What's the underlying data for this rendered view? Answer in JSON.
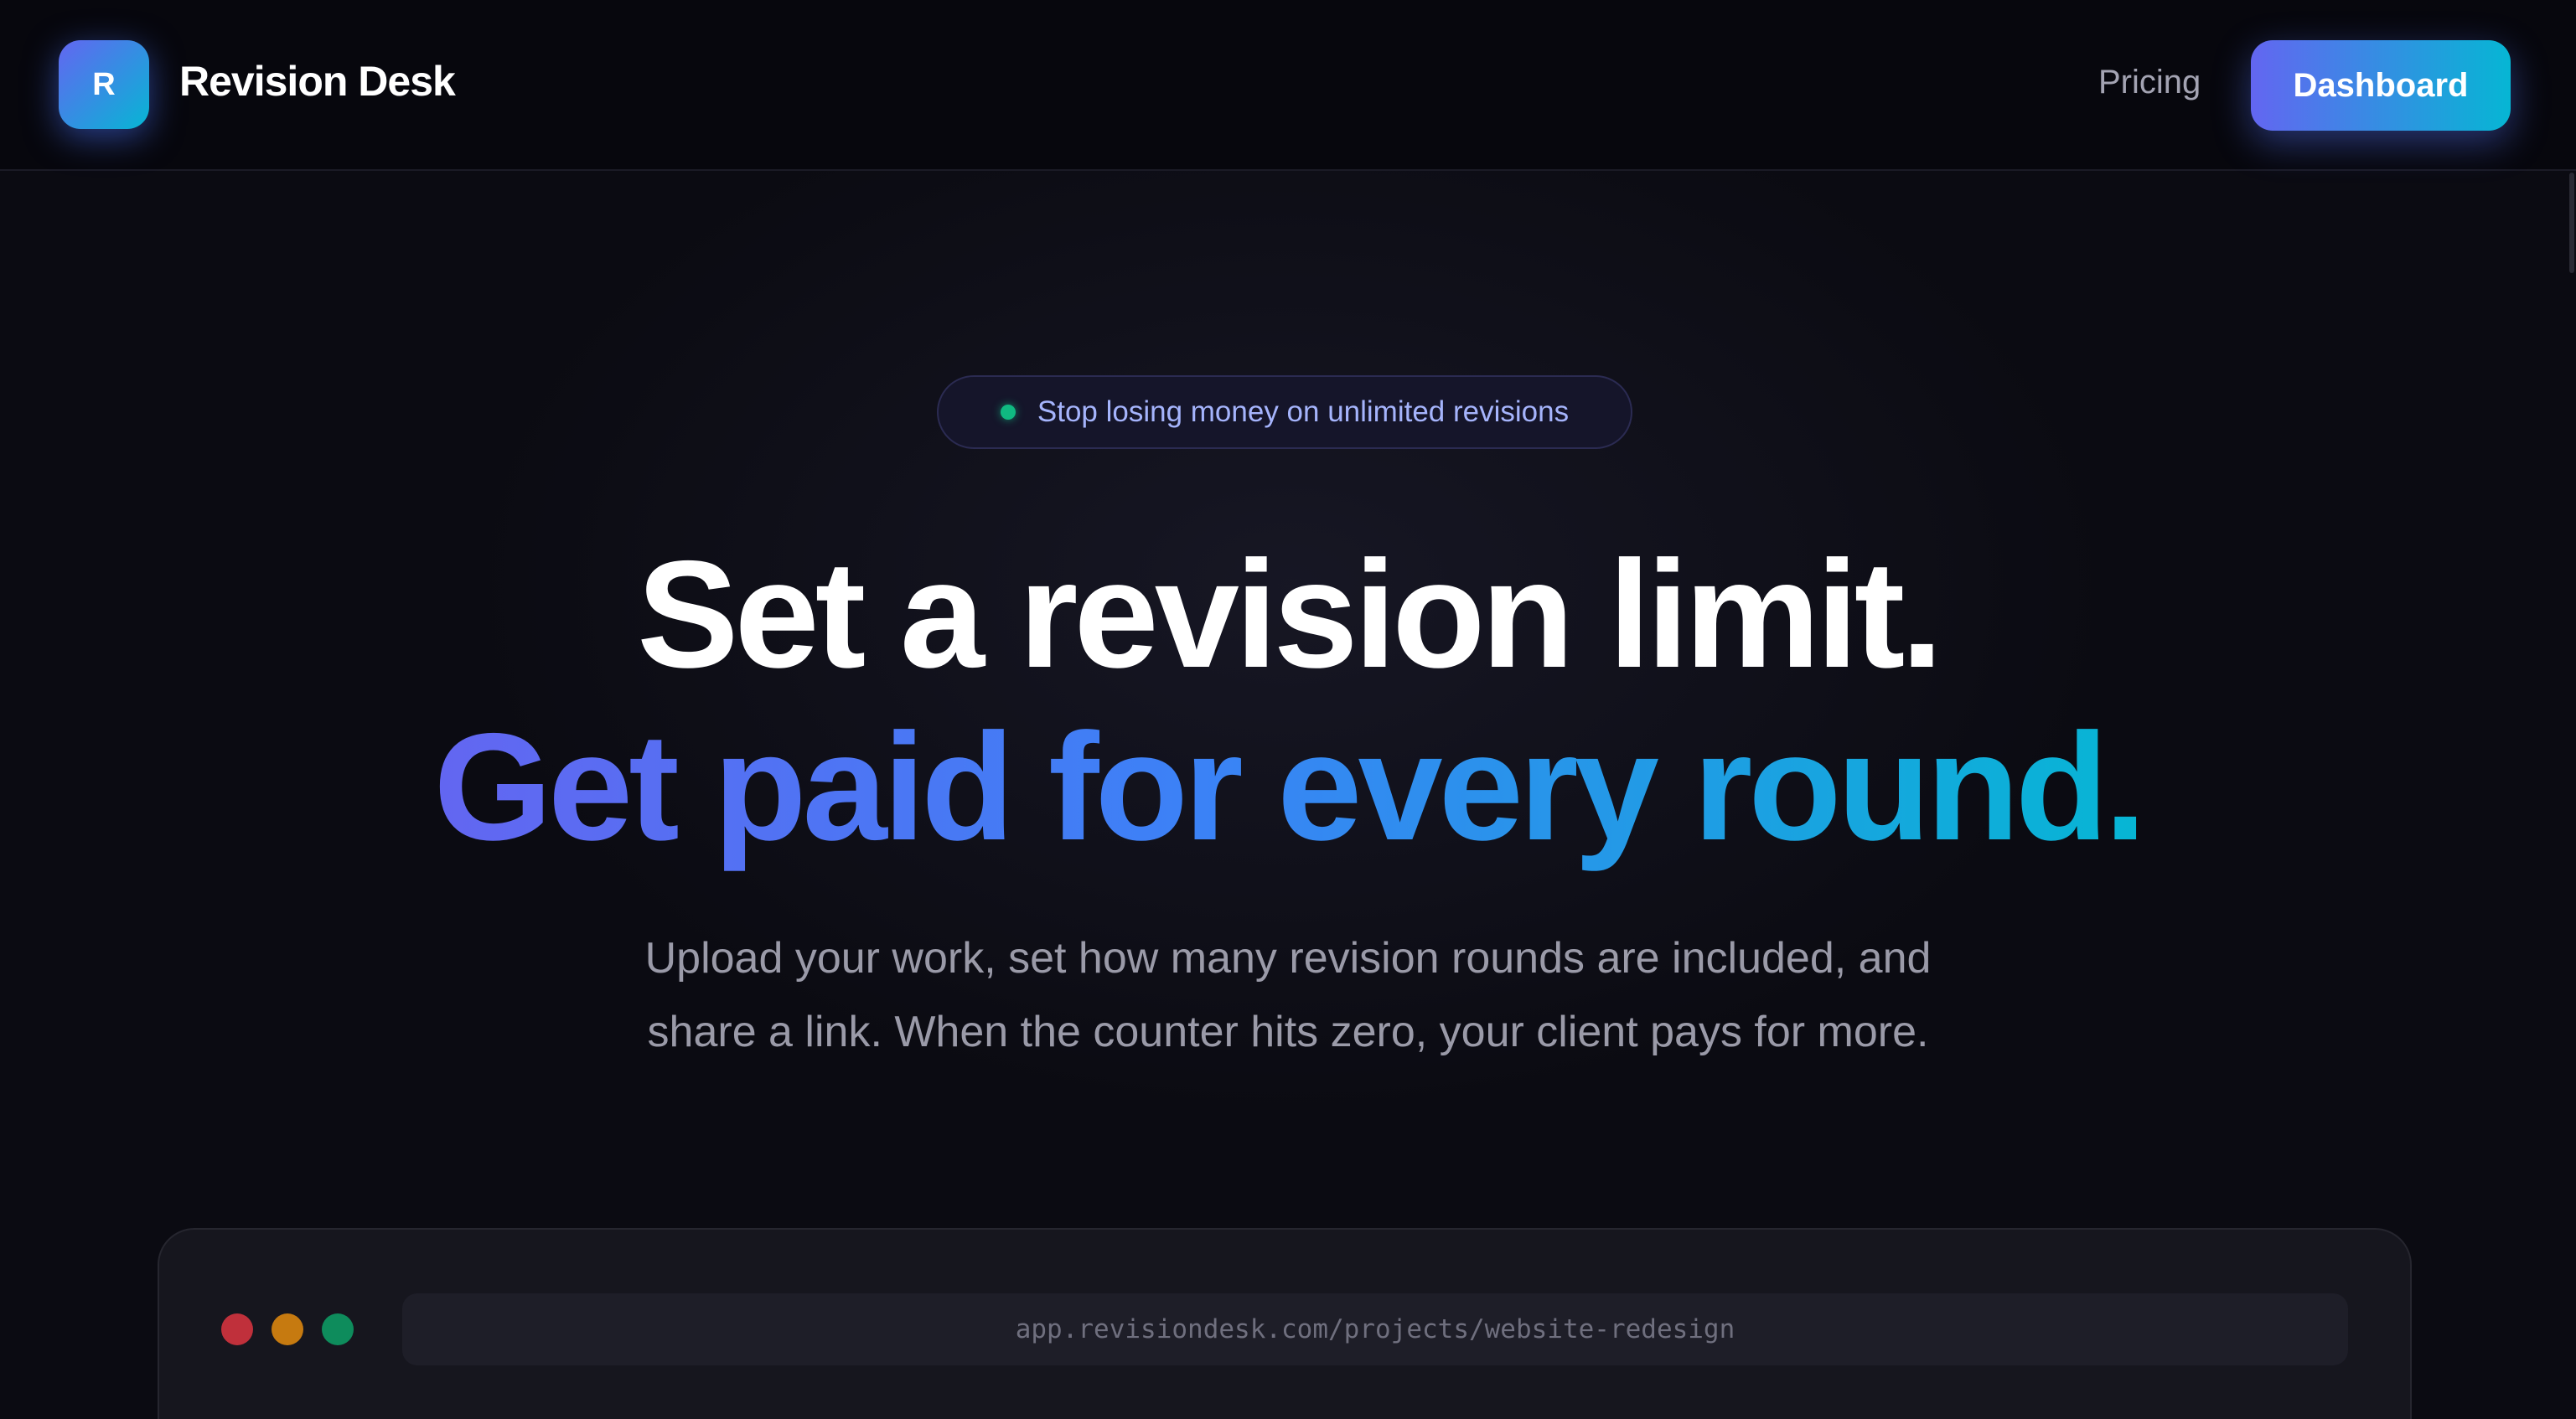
{
  "nav": {
    "logo_letter": "R",
    "brand": "Revision Desk",
    "pricing_label": "Pricing",
    "dashboard_label": "Dashboard"
  },
  "hero": {
    "badge": "Stop losing money on unlimited revisions",
    "headline_line1": "Set a revision limit.",
    "headline_line2": "Get paid for every round.",
    "subtext_line1": "Upload your work, set how many revision rounds are included, and",
    "subtext_line2": "share a link. When the counter hits zero, your client pays for more."
  },
  "preview": {
    "url": "app.revisiondesk.com/projects/website-redesign"
  },
  "colors": {
    "accent_start": "#6366f1",
    "accent_end": "#06b6d4",
    "badge_dot": "#10b981",
    "background": "#0b0b12"
  }
}
